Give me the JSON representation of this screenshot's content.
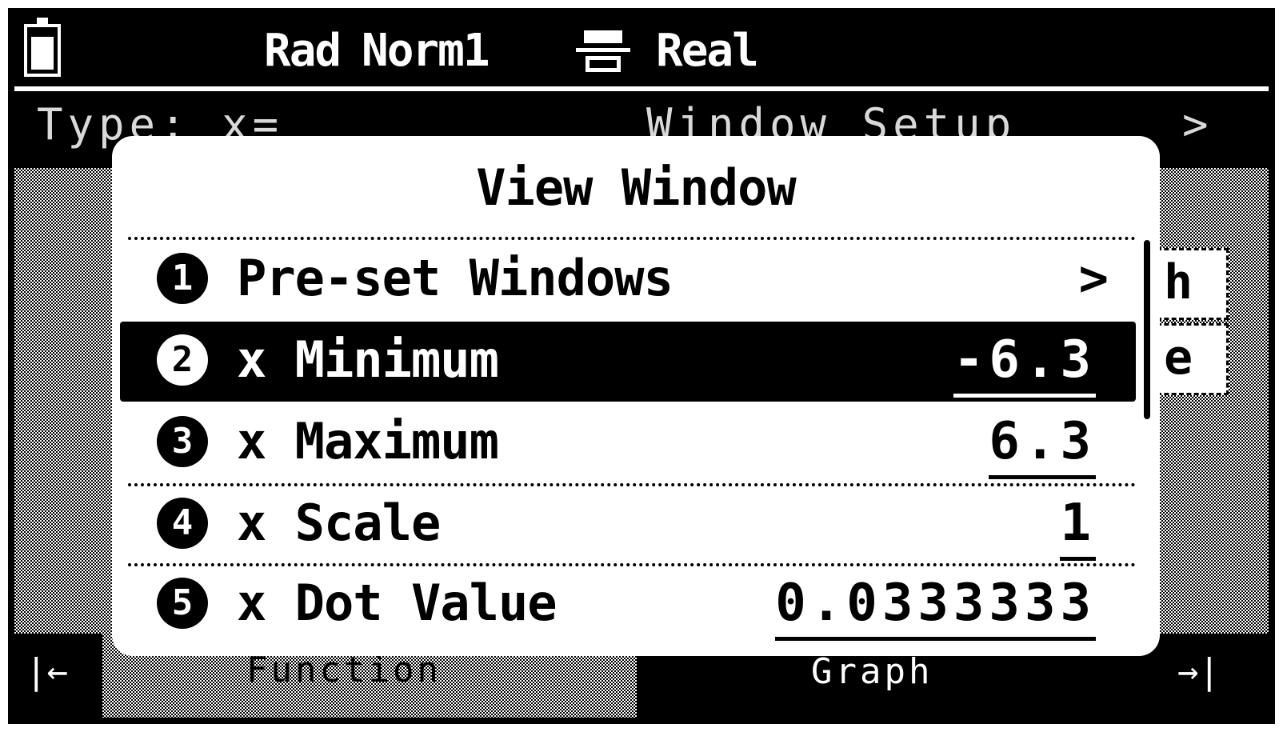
{
  "status_bar": {
    "angle_mode": "Rad",
    "display_mode": "Norm1",
    "complex_mode": "Real"
  },
  "background_app": {
    "header_left": "Type: x=",
    "header_center": "Window Setup",
    "header_right": ">",
    "footer_left_icon": "|←",
    "footer_left_label": "Function",
    "footer_right_label": "Graph",
    "footer_right_icon": "→|",
    "side_tabs": [
      "h",
      "e"
    ]
  },
  "dialog": {
    "title": "View Window",
    "items": [
      {
        "num": "1",
        "label": "Pre-set Windows",
        "value": "",
        "chevron": ">"
      },
      {
        "num": "2",
        "label": "x Minimum",
        "value": "-6.3"
      },
      {
        "num": "3",
        "label": "x Maximum",
        "value": "6.3"
      },
      {
        "num": "4",
        "label": "x Scale",
        "value": "1"
      },
      {
        "num": "5",
        "label": "x Dot Value",
        "value": "0.0333333"
      }
    ],
    "selected_index": 1
  }
}
